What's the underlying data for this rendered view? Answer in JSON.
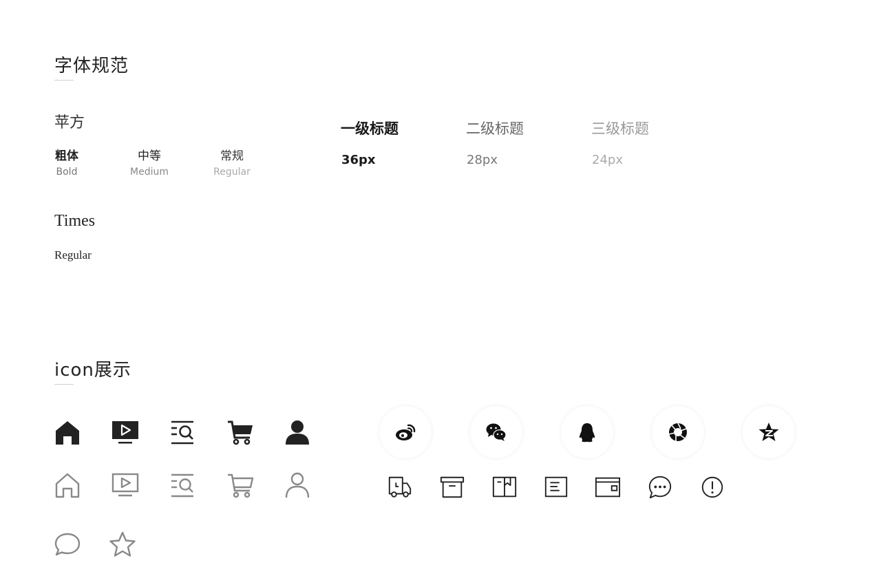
{
  "typography": {
    "section_title": "字体规范",
    "pingfang": {
      "name": "苹方",
      "weights": [
        {
          "cn": "粗体",
          "en": "Bold"
        },
        {
          "cn": "中等",
          "en": "Medium"
        },
        {
          "cn": "常规",
          "en": "Regular"
        }
      ]
    },
    "times": {
      "name": "Times",
      "weight": "Regular"
    },
    "levels": [
      {
        "label": "一级标题",
        "size": "36px",
        "color": "#1a1a1a"
      },
      {
        "label": "二级标题",
        "size": "28px",
        "color": "#666666"
      },
      {
        "label": "三级标题",
        "size": "24px",
        "color": "#999999"
      }
    ]
  },
  "icons": {
    "section_title": "icon展示",
    "filled_row": [
      "home-icon",
      "play-screen-icon",
      "list-search-icon",
      "cart-icon",
      "user-icon"
    ],
    "outline_row": [
      "home-outline-icon",
      "play-screen-outline-icon",
      "list-search-outline-icon",
      "cart-outline-icon",
      "user-outline-icon"
    ],
    "extra_row": [
      "chat-bubble-icon",
      "star-outline-icon"
    ],
    "social": [
      "weibo-icon",
      "wechat-icon",
      "qq-icon",
      "camera-aperture-icon",
      "qzone-icon"
    ],
    "misc": [
      "delivery-truck-icon",
      "archive-box-icon",
      "book-icon",
      "document-icon",
      "wallet-icon",
      "message-dots-icon",
      "alert-circle-icon"
    ],
    "colors": {
      "filled": "#222222",
      "outline": "#888888",
      "dark": "#111111"
    }
  }
}
